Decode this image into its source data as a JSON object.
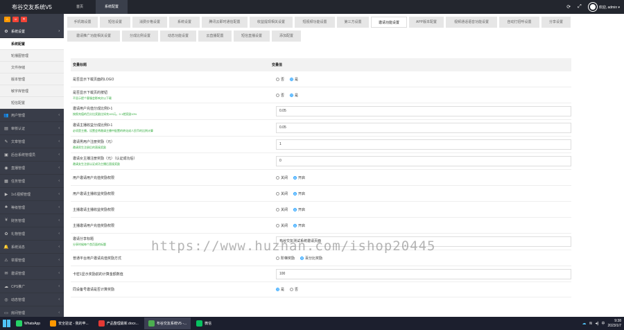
{
  "app": {
    "title": "布谷交友系统V5"
  },
  "topnav": [
    {
      "label": "首页",
      "active": false
    },
    {
      "label": "系统配置",
      "active": true
    }
  ],
  "topright": {
    "refresh_icon": "refresh-icon",
    "fullscreen_icon": "fullscreen-icon",
    "user_label": "欢迎, admin ▾"
  },
  "sidebar": {
    "tools": [
      {
        "icon": "home-icon",
        "color": "#ff9800",
        "glyph": "⌂"
      },
      {
        "icon": "user-icon",
        "color": "#f44336",
        "glyph": "☺"
      },
      {
        "icon": "trash-icon",
        "color": "#f44336",
        "glyph": "✕"
      }
    ],
    "items": [
      {
        "label": "系统设置",
        "icon": "gear-icon",
        "glyph": "⚙",
        "open": true,
        "subs": [
          {
            "label": "系统配置",
            "active": true
          },
          {
            "label": "轮播图管理",
            "active": false
          },
          {
            "label": "文件存储",
            "active": false
          },
          {
            "label": "版本管理",
            "active": false
          },
          {
            "label": "敏字库管理",
            "active": false
          },
          {
            "label": "短信配置",
            "active": false
          }
        ]
      },
      {
        "label": "用户管理",
        "icon": "users-icon",
        "glyph": "👥"
      },
      {
        "label": "审核认证",
        "icon": "audit-icon",
        "glyph": "▤"
      },
      {
        "label": "文章管理",
        "icon": "article-icon",
        "glyph": "✎"
      },
      {
        "label": "后台系统管理员",
        "icon": "admin-icon",
        "glyph": "▣"
      },
      {
        "label": "直播管理",
        "icon": "live-icon",
        "glyph": "◉"
      },
      {
        "label": "任务管理",
        "icon": "task-icon",
        "glyph": "▦"
      },
      {
        "label": "1v1视频管理",
        "icon": "video-icon",
        "glyph": "▶"
      },
      {
        "label": "等级管理",
        "icon": "level-icon",
        "glyph": "♣"
      },
      {
        "label": "财务管理",
        "icon": "finance-icon",
        "glyph": "¥"
      },
      {
        "label": "礼物管理",
        "icon": "gift-icon",
        "glyph": "✿"
      },
      {
        "label": "系统消息",
        "icon": "message-icon",
        "glyph": "🔔"
      },
      {
        "label": "举报管理",
        "icon": "report-icon",
        "glyph": "⚠"
      },
      {
        "label": "邀请管理",
        "icon": "invite-icon",
        "glyph": "✉"
      },
      {
        "label": "CPS推广",
        "icon": "cps-icon",
        "glyph": "☁"
      },
      {
        "label": "动态管理",
        "icon": "dynamic-icon",
        "glyph": "◎"
      },
      {
        "label": "房间管理",
        "icon": "room-icon",
        "glyph": "▭"
      }
    ]
  },
  "tabs": [
    [
      {
        "label": "手机端设置",
        "w": 44
      },
      {
        "label": "短信设置",
        "w": 44
      },
      {
        "label": "消费价格设置",
        "w": 50
      },
      {
        "label": "系统设置",
        "w": 44
      },
      {
        "label": "腾讯云即时通信配置",
        "w": 66
      },
      {
        "label": "收益提现相关设置",
        "w": 62
      },
      {
        "label": "短视频功能设置",
        "w": 58
      },
      {
        "label": "第三方设置",
        "w": 46
      },
      {
        "label": "邀请功能设置",
        "w": 52,
        "active": true
      },
      {
        "label": "APP版本配置",
        "w": 50
      },
      {
        "label": "视频通话语音功能设置",
        "w": 74
      },
      {
        "label": "自动打招呼设置",
        "w": 58
      },
      {
        "label": "分享设置",
        "w": 42
      }
    ],
    [
      {
        "label": "邀请推广功能相关设置",
        "w": 76
      },
      {
        "label": "分成比例设置",
        "w": 52
      },
      {
        "label": "动态功能设置",
        "w": 52
      },
      {
        "label": "云直播配置",
        "w": 48
      },
      {
        "label": "短信直播设置",
        "w": 52
      },
      {
        "label": "添加配置",
        "w": 42
      }
    ]
  ],
  "table": {
    "col1": "变量标题",
    "col2": "变量值",
    "rows": [
      {
        "label": "是否显示下载页面的LOGO",
        "hint": "",
        "type": "radio",
        "options": [
          "否",
          "是"
        ],
        "selected": 1,
        "h": 23
      },
      {
        "label": "是否显示下载页的按钮",
        "hint": "不显示提个客服会影响文以下载",
        "type": "radio",
        "options": [
          "否",
          "是"
        ],
        "selected": 1,
        "h": 23
      },
      {
        "label": "邀请用户充值分成比例0-1",
        "hint": "按照充值的百分比奖励比如充100元，0.1就奖励10%",
        "type": "input",
        "value": "0.05",
        "h": 24
      },
      {
        "label": "邀请主播收益分成比例0-1",
        "hint": "必须是主播，设置会将邀请主播中配置的转化成人民币的比例计算",
        "type": "input",
        "value": "0.05",
        "h": 24
      },
      {
        "label": "邀请男用户注册奖励（元）",
        "hint": "邀请男生注册后的直接奖励",
        "type": "input",
        "value": "1",
        "h": 24
      },
      {
        "label": "邀请女主播注册奖励（元）（认证成功后）",
        "hint": "邀请女生注册认证成功主播后直接奖励",
        "type": "input",
        "value": "0",
        "h": 24
      },
      {
        "label": "用户邀请用户充值奖励权限",
        "hint": "",
        "type": "radio",
        "options": [
          "关闭",
          "开启"
        ],
        "selected": 1,
        "h": 23
      },
      {
        "label": "用户邀请主播收益奖励权限",
        "hint": "",
        "type": "radio",
        "options": [
          "关闭",
          "开启"
        ],
        "selected": 1,
        "h": 23
      },
      {
        "label": "主播邀请主播收益奖励权限",
        "hint": "",
        "type": "radio",
        "options": [
          "关闭",
          "开启"
        ],
        "selected": 1,
        "h": 23
      },
      {
        "label": "主播邀请用户充值奖励权限",
        "hint": "",
        "type": "radio",
        "options": [
          "关闭",
          "开启"
        ],
        "selected": 1,
        "h": 23
      },
      {
        "label": "邀请分享标题",
        "hint": "分享时候每个首页面的标题",
        "type": "input",
        "value": "布谷交友测试系统邀请页面",
        "h": 24
      },
      {
        "label": "普通平台用户邀请充值奖励方式",
        "hint": "",
        "type": "radio",
        "options": [
          "阶梯奖励",
          "百分比奖励"
        ],
        "selected": 1,
        "h": 23
      },
      {
        "label": "卡密1显示奖励前的计算金额数值",
        "hint": "",
        "type": "input",
        "value": "100",
        "h": 23
      },
      {
        "label": "同设备号邀请是否计算奖励",
        "hint": "",
        "type": "radio",
        "options": [
          "是",
          "否"
        ],
        "selected": 0,
        "h": 22
      }
    ]
  },
  "watermark": "https://www.huzhan.com/ishop20445",
  "taskbar": {
    "apps": [
      {
        "label": "WhatsApp",
        "color": "#25d366",
        "active": false
      },
      {
        "label": "安全验证 - 我的苹...",
        "color": "#ff9800",
        "active": false
      },
      {
        "label": "产品整理最新.docx...",
        "color": "#e53935",
        "active": false
      },
      {
        "label": "布谷交友系统V5 -...",
        "color": "#4caf50",
        "active": true
      },
      {
        "label": "微信",
        "color": "#07c160",
        "active": false
      }
    ],
    "tray_icons": [
      "cloud-icon",
      "wifi-icon",
      "volume-icon",
      "ime-icon"
    ],
    "ime": "中",
    "time": "9:38",
    "date": "2023/1/7"
  }
}
